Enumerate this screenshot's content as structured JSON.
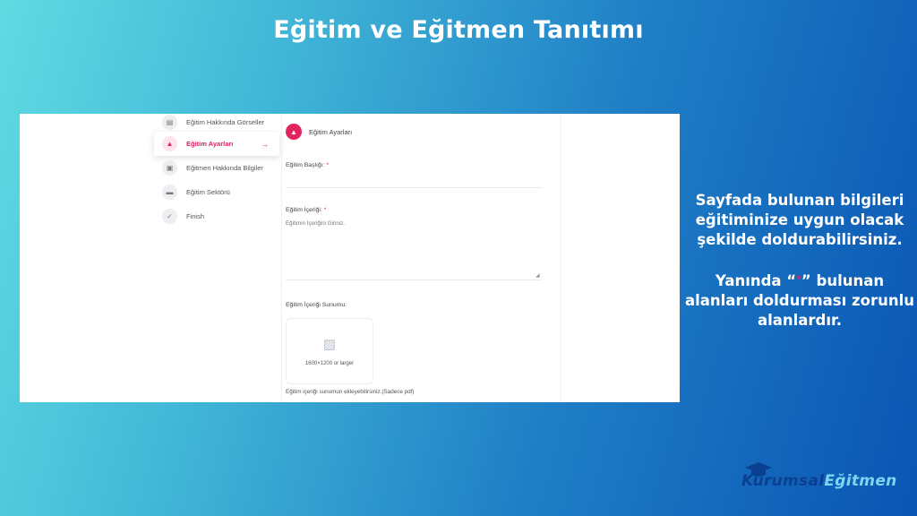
{
  "slide": {
    "title": "Eğitim ve Eğitmen Tanıtımı",
    "info": {
      "paragraph1": [
        "Sayfada bulunan bilgileri",
        "eğitiminize uygun olacak",
        "şekilde doldurabilirsiniz."
      ],
      "paragraph2_before": "Yanında “",
      "paragraph2_star": "*",
      "paragraph2_after": "” bulunan",
      "paragraph2_lines": [
        "alanları doldurması zorunlu",
        "alanlardır."
      ]
    }
  },
  "nav": {
    "items": [
      {
        "label": "Eğitim Hakkında Görseller",
        "icon": "images-icon",
        "active": false
      },
      {
        "label": "Eğitim Ayarları",
        "icon": "graduation-cap-icon",
        "active": true
      },
      {
        "label": "Eğitmen Hakkında Bilgiler",
        "icon": "id-card-icon",
        "active": false
      },
      {
        "label": "Eğitim Sektörü",
        "icon": "folder-icon",
        "active": false
      },
      {
        "label": "Finish",
        "icon": "check-icon",
        "active": false
      }
    ],
    "active_arrow": "→"
  },
  "form": {
    "section_title": "Eğitim Ayarları",
    "title_label": "Eğitim Başlığı:",
    "content_label": "Eğitim İçeriği:",
    "content_placeholder": "Eğitimin İçeriğini Giriniz.",
    "required_mark": "*",
    "presentation_label": "Eğitim İçeriği Sunumu:",
    "upload_size_text": "1600×1200 or larger",
    "upload_hint": "Eğitim içeriği sunumun ekleyebilirsiniz.(Sadece pdf)"
  },
  "brand": {
    "part1": "Kurumsal",
    "part2": "Eğitmen",
    "icon": "graduation-cap-icon"
  },
  "colors": {
    "accent": "#e0245e",
    "brand_dark": "#0b3f8f",
    "brand_light": "#7cd6f0"
  }
}
